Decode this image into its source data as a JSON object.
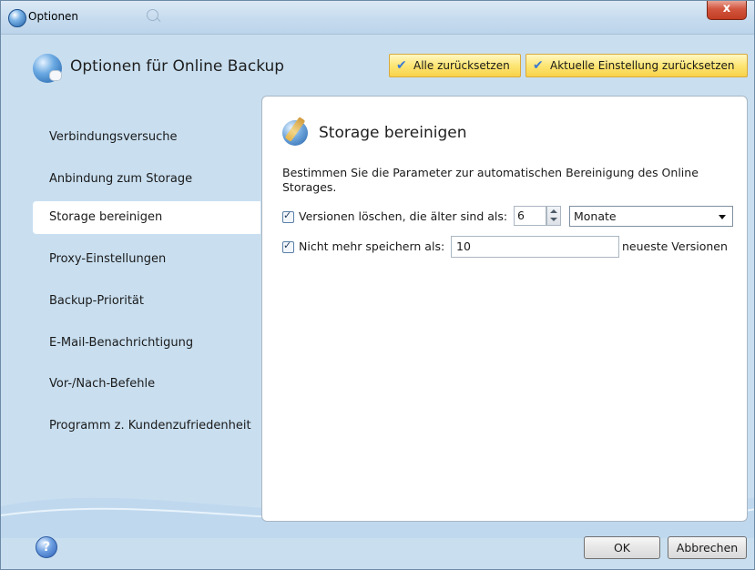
{
  "window": {
    "title": "Optionen",
    "close_label": "x"
  },
  "header": {
    "title": "Optionen für Online Backup",
    "reset_all_label": "Alle zurücksetzen",
    "reset_current_label": "Aktuelle Einstellung zurücksetzen"
  },
  "sidebar": {
    "items": [
      {
        "label": "Verbindungsversuche"
      },
      {
        "label": "Anbindung zum Storage"
      },
      {
        "label": "Storage bereinigen",
        "active": true
      },
      {
        "label": "Proxy-Einstellungen"
      },
      {
        "label": "Backup-Priorität"
      },
      {
        "label": "E-Mail-Benachrichtigung"
      },
      {
        "label": "Vor-/Nach-Befehle"
      },
      {
        "label": "Programm z. Kundenzufriedenheit"
      }
    ]
  },
  "content": {
    "title": "Storage bereinigen",
    "description": "Bestimmen Sie die Parameter zur automatischen Bereinigung des Online Storages.",
    "delete_older": {
      "checked": true,
      "label": "Versionen löschen, die älter sind als:",
      "value": "6",
      "unit": "Monate"
    },
    "keep_latest": {
      "checked": true,
      "label": "Nicht mehr speichern als:",
      "value": "10",
      "suffix": "neueste Versionen"
    }
  },
  "footer": {
    "help_label": "?",
    "ok_label": "OK",
    "cancel_label": "Abbrechen"
  },
  "colors": {
    "window_bg": "#c9dff0",
    "accent_button": "#fde675",
    "close_button": "#c23d23"
  }
}
